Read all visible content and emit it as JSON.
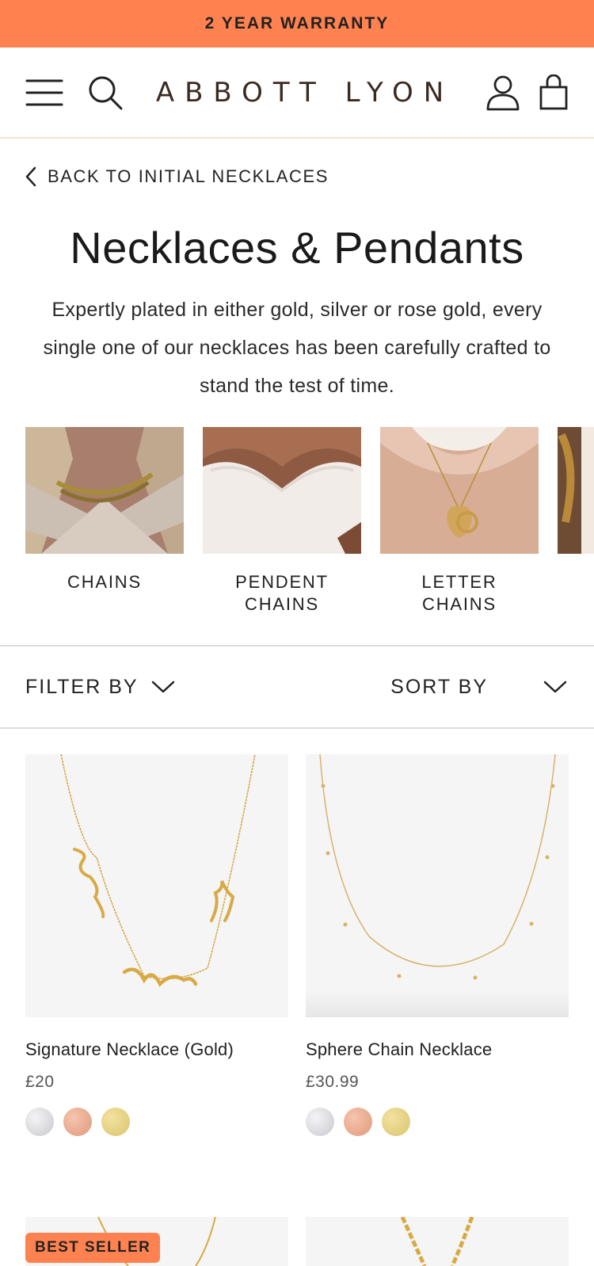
{
  "promo": {
    "text": "2 YEAR WARRANTY"
  },
  "header": {
    "logo": "ABBOTT LYON",
    "icons": [
      "menu-icon",
      "search-icon",
      "account-icon",
      "bag-icon"
    ]
  },
  "back_link": {
    "label": "BACK TO INITIAL NECKLACES"
  },
  "page": {
    "title": "Necklaces & Pendants",
    "description": "Expertly plated in either gold, silver or rose gold, every single one of our necklaces has been carefully crafted to stand the test of time."
  },
  "categories": [
    {
      "label": "CHAINS"
    },
    {
      "label": "PENDENT CHAINS"
    },
    {
      "label": "LETTER CHAINS"
    }
  ],
  "filter": {
    "filter_label": "FILTER BY",
    "sort_label": "SORT BY"
  },
  "products": [
    {
      "name": "Signature Necklace (Gold)",
      "price": "£20",
      "swatches": [
        "#d9dadd",
        "#e8a387",
        "#e6cf7e"
      ]
    },
    {
      "name": "Sphere Chain Necklace",
      "price": "£30.99",
      "swatches": [
        "#d9dadd",
        "#e8a387",
        "#e6cf7e"
      ]
    }
  ],
  "badge": {
    "label": "BEST SELLER"
  },
  "colors": {
    "accent": "#ff8250",
    "divider": "#dedede",
    "gold": "#d8aa45"
  }
}
